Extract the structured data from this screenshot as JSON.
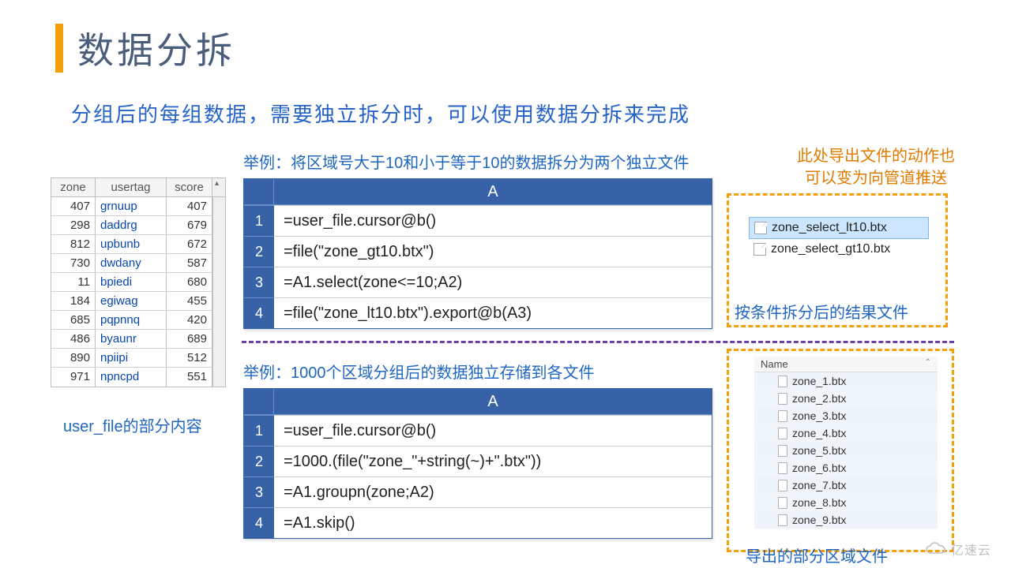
{
  "title": "数据分拆",
  "subtitle": "分组后的每组数据，需要独立拆分时，可以使用数据分拆来完成",
  "watermark": "亿速云",
  "left_table": {
    "headers": {
      "zone": "zone",
      "usertag": "usertag",
      "score": "score"
    },
    "rows": [
      {
        "zone": "407",
        "usertag": "grnuup",
        "score": "407"
      },
      {
        "zone": "298",
        "usertag": "daddrg",
        "score": "679"
      },
      {
        "zone": "812",
        "usertag": "upbunb",
        "score": "672"
      },
      {
        "zone": "730",
        "usertag": "dwdany",
        "score": "587"
      },
      {
        "zone": "11",
        "usertag": "bpiedi",
        "score": "680"
      },
      {
        "zone": "184",
        "usertag": "egiwag",
        "score": "455"
      },
      {
        "zone": "685",
        "usertag": "pqpnnq",
        "score": "420"
      },
      {
        "zone": "486",
        "usertag": "byaunr",
        "score": "689"
      },
      {
        "zone": "890",
        "usertag": "npiipi",
        "score": "512"
      },
      {
        "zone": "971",
        "usertag": "npncpd",
        "score": "551"
      }
    ],
    "caption": "user_file的部分内容"
  },
  "example1": {
    "label": "举例：将区域号大于10和小于等于10的数据拆分为两个独立文件",
    "col": "A",
    "rows": [
      "=user_file.cursor@b()",
      "=file(\"zone_gt10.btx\")",
      "=A1.select(zone<=10;A2)",
      "=file(\"zone_lt10.btx\").export@b(A3)"
    ]
  },
  "example2": {
    "label": "举例：1000个区域分组后的数据独立存储到各文件",
    "col": "A",
    "rows": [
      "=user_file.cursor@b()",
      "=1000.(file(\"zone_\"+string(~)+\".btx\"))",
      "=A1.groupn(zone;A2)",
      "=A1.skip()"
    ]
  },
  "orange_note": {
    "l1": "此处导出文件的动作也",
    "l2": "可以变为向管道推送"
  },
  "filelist1": {
    "items": [
      "zone_select_lt10.btx",
      "zone_select_gt10.btx"
    ],
    "caption": "按条件拆分后的结果文件"
  },
  "filelist2": {
    "header": "Name",
    "items": [
      "zone_1.btx",
      "zone_2.btx",
      "zone_3.btx",
      "zone_4.btx",
      "zone_5.btx",
      "zone_6.btx",
      "zone_7.btx",
      "zone_8.btx",
      "zone_9.btx"
    ],
    "caption": "导出的部分区域文件"
  }
}
